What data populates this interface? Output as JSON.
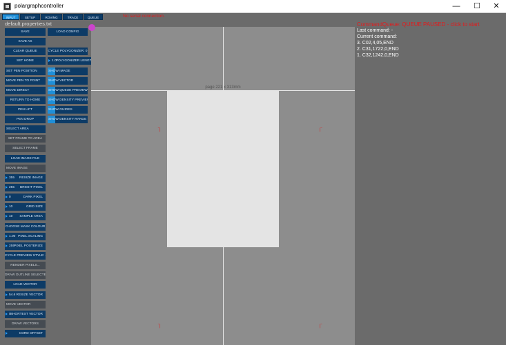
{
  "window": {
    "title": "polargraphcontroller",
    "minimize": "—",
    "maximize": "☐",
    "close": "✕"
  },
  "tabs": [
    "INPUT",
    "SETUP",
    "ROVING",
    "TRACE",
    "QUEUE"
  ],
  "status_message": "No serial connection.",
  "properties_file": "default.properties.txt",
  "controls": {
    "save": "SAVE",
    "save_as": "SAVE AS",
    "clear_queue": "CLEAR QUEUE",
    "set_home": "SET HOME",
    "set_pen_position": "SET PEN POSITION",
    "move_pen_to_point": "MOVE PEN TO POINT",
    "move_direct": "MOVE DIRECT",
    "return_to_home": "RETURN TO HOME",
    "pen_lift": "PEN LIFT",
    "pen_drop": "PEN DROP",
    "select_area": "SELECT AREA",
    "set_frame_to_area": "SET FRAME TO AREA",
    "select_frame": "SELECT FRAME",
    "load_image_file": "LOAD IMAGE FILE",
    "move_image": "MOVE IMAGE",
    "resize_image": {
      "value": "355",
      "label": "RESIZE IMAGE"
    },
    "bright_pixel": {
      "value": "255",
      "label": "BRIGHT PIXEL"
    },
    "dark_pixel": {
      "value": "0",
      "label": "DARK PIXEL"
    },
    "grid_size": {
      "value": "10",
      "label": "GRID SIZE"
    },
    "sample_area": {
      "value": "10",
      "label": "SAMPLE AREA"
    },
    "choose_mask_colour": "CHOOSE MASK COLOUR",
    "pixel_scaling": {
      "value": "1.00",
      "label": "PIXEL SCALING"
    },
    "pixel_posterize": {
      "value": "255",
      "label": "PIXEL POSTERIZE"
    },
    "cycle_preview_style": "CYCLE PREVIEW STYLE: 4",
    "render_pixels": "RENDER PIXELS...",
    "draw_outline_selected": "DRAW OUTLINE SELECTED",
    "load_vector": "LOAD VECTOR",
    "resize_vector": {
      "value": "54.6",
      "label": "RESIZE VECTOR"
    },
    "move_vector": "MOVE VECTOR",
    "shortest_vector": {
      "value": "0",
      "label": "SHORTEST VECTOR"
    },
    "draw_vectors": "DRAW VECTORS",
    "coord_offset": {
      "value": "",
      "label": "CORD OFFSET"
    },
    "load_config": "LOAD CONFIG",
    "cycle_polygonizer": "CYCLE POLYGONIZER: 0",
    "polygonizer_length": {
      "value": "1.0",
      "label": "POLYGONIZER LENGTH"
    },
    "show_image": "SHOW IMAGE",
    "show_vector": "SHOW VECTOR",
    "show_queue_preview": "SHOW QUEUE PREVIEW",
    "show_density_preview": "SHOW DENSITY PREVIEW",
    "show_guides": "SHOW GUIDES",
    "show_density_range": "SHOW DENSITY RANGE"
  },
  "canvas": {
    "page_label": "page 221 x 313mm"
  },
  "queue": {
    "title": "CommandQueue: QUEUE PAUSED - click to start",
    "last_command": "Last command: -",
    "current_command": "Current command:",
    "items": [
      "3. C02,4,05,END",
      "2. C31,1722,0,END",
      "1. C32,1242,0,END"
    ]
  },
  "colors": {
    "button": "#0d3b66",
    "button_active": "#1f8fd8",
    "alert": "#e31a1c",
    "panel_bg": "#6b6b6b",
    "canvas_bg": "#8d8d8d"
  }
}
